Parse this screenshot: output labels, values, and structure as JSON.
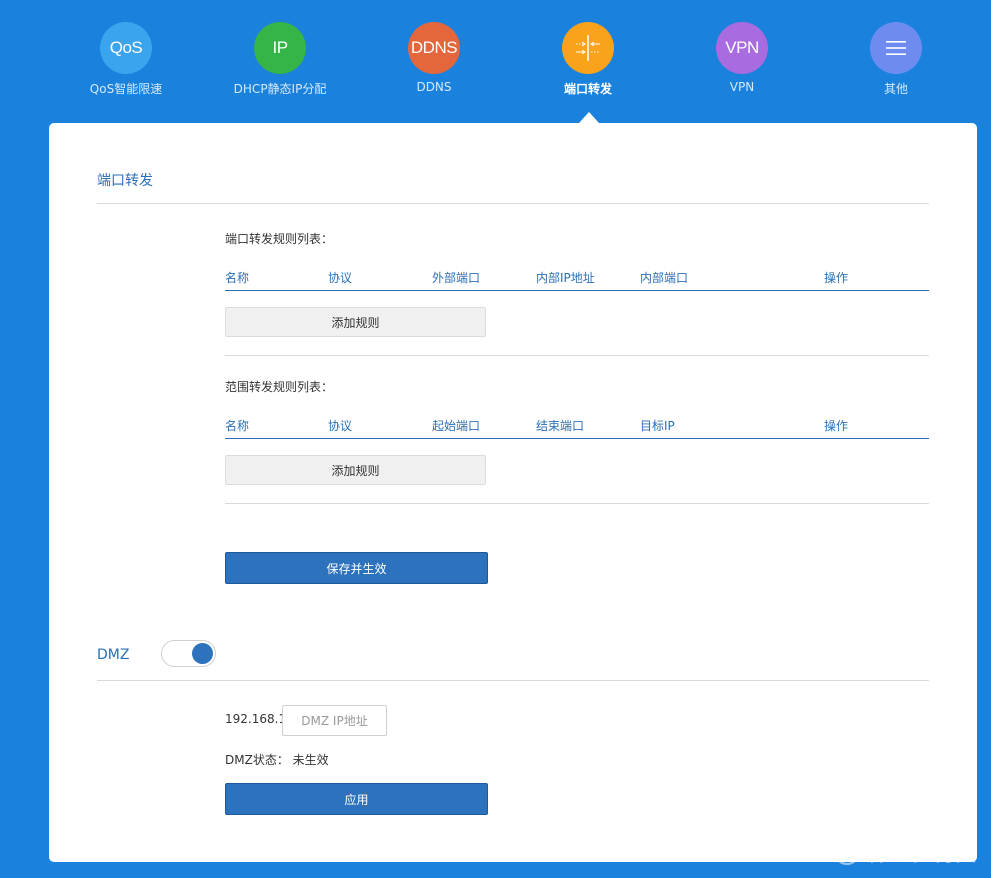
{
  "nav": {
    "items": [
      {
        "icon_text": "QoS",
        "label": "QoS智能限速",
        "color": "#3aa5ee"
      },
      {
        "icon_text": "IP",
        "label": "DHCP静态IP分配",
        "color": "#35b548"
      },
      {
        "icon_text": "DDNS",
        "label": "DDNS",
        "color": "#e3663d"
      },
      {
        "icon_text": "",
        "label": "端口转发",
        "color": "#f9a21b",
        "active": true
      },
      {
        "icon_text": "VPN",
        "label": "VPN",
        "color": "#a86be0"
      },
      {
        "icon_text": "",
        "label": "其他",
        "color": "#6e8cef"
      }
    ]
  },
  "port_forward": {
    "title": "端口转发",
    "port_rules": {
      "heading": "端口转发规则列表：",
      "columns": [
        "名称",
        "协议",
        "外部端口",
        "内部IP地址",
        "内部端口",
        "操作"
      ],
      "add_label": "添加规则"
    },
    "range_rules": {
      "heading": "范围转发规则列表：",
      "columns": [
        "名称",
        "协议",
        "起始端口",
        "结束端口",
        "目标IP",
        "操作"
      ],
      "add_label": "添加规则"
    },
    "save_label": "保存并生效"
  },
  "dmz": {
    "title": "DMZ",
    "enabled": true,
    "ip_prefix": "192.168.1.",
    "ip_placeholder": "DMZ IP地址",
    "status_label": "DMZ状态：",
    "status_value": "未生效",
    "apply_label": "应用"
  },
  "watermark": {
    "text": "什么值得买"
  },
  "colors": {
    "background": "#1a82dc",
    "accent": "#2c72bd",
    "title": "#2a6fb7"
  }
}
